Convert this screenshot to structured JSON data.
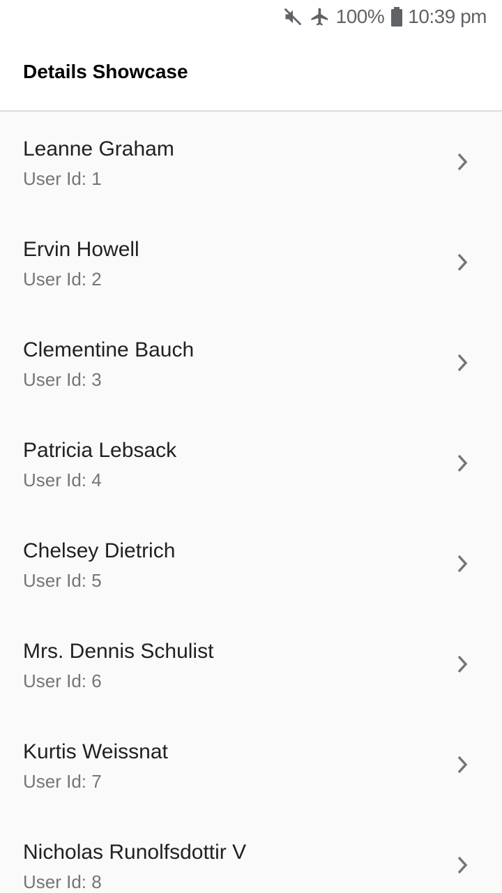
{
  "status_bar": {
    "battery": "100%",
    "time": "10:39 pm",
    "icons": [
      "mute-icon",
      "airplane-icon",
      "battery-icon"
    ]
  },
  "app_bar": {
    "title": "Details Showcase"
  },
  "users": [
    {
      "name": "Leanne Graham",
      "subtitle": "User Id: 1"
    },
    {
      "name": "Ervin Howell",
      "subtitle": "User Id: 2"
    },
    {
      "name": "Clementine Bauch",
      "subtitle": "User Id: 3"
    },
    {
      "name": "Patricia Lebsack",
      "subtitle": "User Id: 4"
    },
    {
      "name": "Chelsey Dietrich",
      "subtitle": "User Id: 5"
    },
    {
      "name": "Mrs. Dennis Schulist",
      "subtitle": "User Id: 6"
    },
    {
      "name": "Kurtis Weissnat",
      "subtitle": "User Id: 7"
    },
    {
      "name": "Nicholas Runolfsdottir V",
      "subtitle": "User Id: 8"
    }
  ],
  "colors": {
    "icon_gray": "#757575",
    "status_gray": "#5f6368"
  }
}
